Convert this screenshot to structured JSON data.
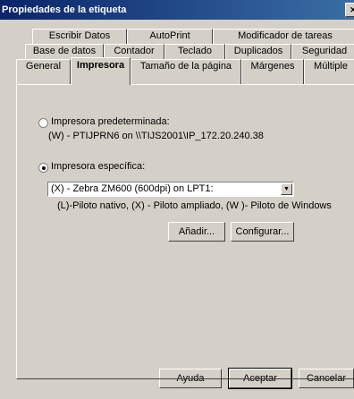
{
  "window": {
    "title": "Propiedades de la etiqueta"
  },
  "tabs": {
    "row1": [
      "Escribir Datos",
      "AutoPrint",
      "Modificador de tareas"
    ],
    "row2": [
      "Base de datos",
      "Contador",
      "Teclado",
      "Duplicados",
      "Seguridad"
    ],
    "row3": [
      "General",
      "Impresora",
      "Tamaño de la página",
      "Márgenes",
      "Múltiple"
    ],
    "active": "Impresora"
  },
  "printer": {
    "default_radio_label": "Impresora predeterminada:",
    "default_printer_value": "(W) - PTIJPRN6 on \\\\TIJS2001\\IP_172.20.240.38",
    "specific_radio_label": "Impresora específica:",
    "selected_printer": "(X) - Zebra ZM600 (600dpi) on LPT1:",
    "legend": "(L)-Piloto nativo, (X) - Piloto ampliado, (W )- Piloto de Windows",
    "add_label": "Añadir...",
    "configure_label": "Configurar..."
  },
  "footer": {
    "help_label": "Ayuda",
    "accept_label": "Aceptar",
    "cancel_label": "Cancelar"
  }
}
